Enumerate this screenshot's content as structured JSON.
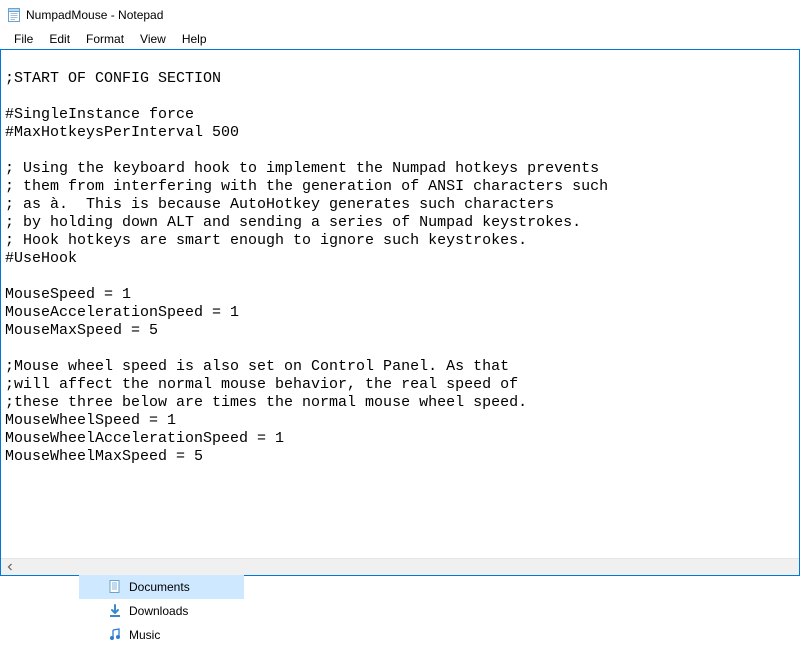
{
  "window": {
    "title": "NumpadMouse - Notepad"
  },
  "menu": {
    "file": "File",
    "edit": "Edit",
    "format": "Format",
    "view": "View",
    "help": "Help"
  },
  "editor": {
    "content": "\n;START OF CONFIG SECTION\n\n#SingleInstance force\n#MaxHotkeysPerInterval 500\n\n; Using the keyboard hook to implement the Numpad hotkeys prevents\n; them from interfering with the generation of ANSI characters such\n; as à.  This is because AutoHotkey generates such characters\n; by holding down ALT and sending a series of Numpad keystrokes.\n; Hook hotkeys are smart enough to ignore such keystrokes.\n#UseHook\n\nMouseSpeed = 1\nMouseAccelerationSpeed = 1\nMouseMaxSpeed = 5\n\n;Mouse wheel speed is also set on Control Panel. As that\n;will affect the normal mouse behavior, the real speed of\n;these three below are times the normal mouse wheel speed.\nMouseWheelSpeed = 1\nMouseWheelAccelerationSpeed = 1\nMouseWheelMaxSpeed = 5\n"
  },
  "explorer": {
    "items": [
      {
        "label": "Documents",
        "icon": "documents",
        "selected": true
      },
      {
        "label": "Downloads",
        "icon": "downloads",
        "selected": false
      },
      {
        "label": "Music",
        "icon": "music",
        "selected": false
      }
    ]
  }
}
